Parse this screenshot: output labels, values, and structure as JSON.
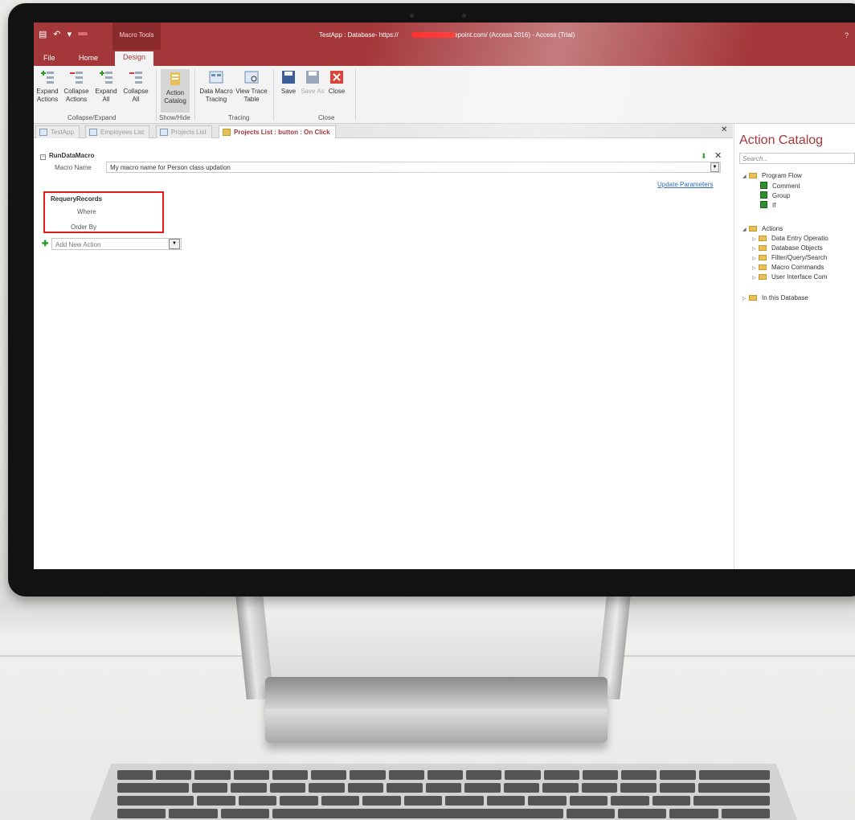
{
  "window": {
    "context_tab": "Macro Tools",
    "title": "TestApp : Database- https://",
    "title_suffix": "harepoint.com/ (Access 2016) - Access (Trial)",
    "help": "?"
  },
  "ribbon_tabs": [
    "File",
    "Home",
    "Design"
  ],
  "ribbon": {
    "expand_actions": "Expand Actions",
    "collapse_actions": "Collapse Actions",
    "expand_all": "Expand All",
    "collapse_all": "Collapse All",
    "group_collapse_expand": "Collapse/Expand",
    "action_catalog": "Action Catalog",
    "group_show_hide": "Show/Hide",
    "data_macro_tracing": "Data Macro Tracing",
    "view_trace_table": "View Trace Table",
    "group_tracing": "Tracing",
    "save": "Save",
    "save_as": "Save As",
    "close": "Close",
    "group_close": "Close"
  },
  "doc_tabs": [
    "TestApp",
    "Employees List",
    "Projects List",
    "Projects List : button : On Click"
  ],
  "macro": {
    "block_title": "RunDataMacro",
    "macro_name_label": "Macro Name",
    "macro_name_value": "My macro name for Person class updation",
    "update_parameters": "Update Parameters",
    "action_title": "RequeryRecords",
    "where_label": "Where",
    "order_by_label": "Order By",
    "add_new_action_placeholder": "Add New Action"
  },
  "catalog": {
    "title": "Action Catalog",
    "search_placeholder": "Search...",
    "program_flow": "Program Flow",
    "program_flow_items": [
      "Comment",
      "Group",
      "If"
    ],
    "actions": "Actions",
    "action_groups": [
      "Data Entry Operatio",
      "Database Objects",
      "Filter/Query/Search",
      "Macro Commands",
      "User Interface Com"
    ],
    "in_this_database": "In this Database"
  },
  "colors": {
    "accent": "#a4373a",
    "highlight_box": "#e41c1c",
    "link": "#2563b0"
  }
}
